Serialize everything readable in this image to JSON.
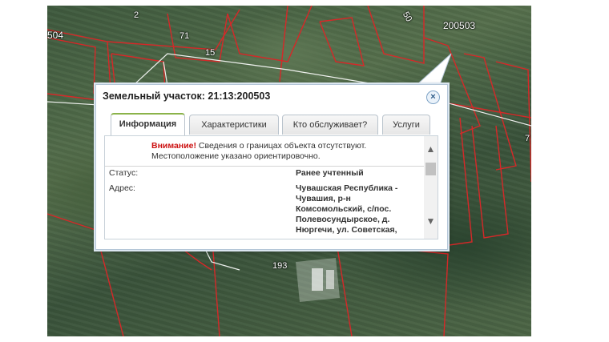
{
  "map": {
    "plot_labels": [
      "2",
      "504",
      "71",
      "15",
      "50",
      "200503",
      "193",
      "7"
    ]
  },
  "popup": {
    "title": "Земельный участок: 21:13:200503",
    "close_symbol": "×",
    "tabs": [
      {
        "label": "Информация",
        "active": true
      },
      {
        "label": "Характеристики",
        "active": false
      },
      {
        "label": "Кто обслуживает?",
        "active": false
      },
      {
        "label": "Услуги",
        "active": false
      }
    ],
    "warning_prefix": "Внимание!",
    "warning_text": " Сведения о границах объекта отсутствуют. Местоположение указано ориентировочно.",
    "fields": [
      {
        "label": "Статус:",
        "value": "Ранее учтенный"
      },
      {
        "label": "Адрес:",
        "value": "Чувашская Республика - Чувашия, р-н Комсомольский, с/пос. Полевосундырское, д. Нюргечи, ул. Советская,"
      }
    ],
    "scroll_up_icon": "▲",
    "scroll_down_icon": "▼"
  },
  "colors": {
    "boundary": "#d62828",
    "active_tab_accent": "#8bb34a",
    "warning": "#cc1111"
  }
}
